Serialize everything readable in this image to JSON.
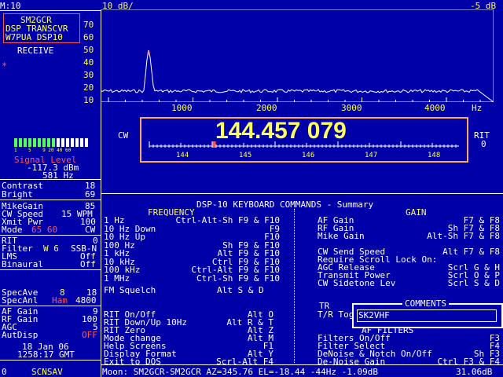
{
  "top_left": {
    "mode_label": "M:10"
  },
  "station_box": {
    "line1": "SM2GCR",
    "line2": "DSP TRANSCVR",
    "line3": "W7PUA DSP10"
  },
  "receive_label": "RECEIVE",
  "spectrum": {
    "header_left": "10 dB/",
    "header_right": "-5 dB",
    "y_ticks": [
      "70",
      "60",
      "50",
      "40",
      "30",
      "20",
      "10"
    ],
    "x_ticks": [
      "1000",
      "2000",
      "3000",
      "4000"
    ],
    "x_unit": "Hz"
  },
  "signal": {
    "bar_scale": "1    5    9 20 40 60",
    "label": "Signal Level",
    "level": "-117.3 dBm",
    "freq": "581 Hz",
    "bars_lit_fraction": 0.55
  },
  "tuning": {
    "mode": "CW",
    "frequency": "144.457 079",
    "rit_label": "RIT",
    "rit_value": "0",
    "scale_labels": [
      "144",
      "145",
      "146",
      "147",
      "148"
    ],
    "marker_value": 144.457
  },
  "settings": {
    "contrast_label": "Contrast",
    "contrast_value": "18",
    "bright_label": "Bright",
    "bright_value": "69",
    "mikegain_label": "MikeGain",
    "mikegain_value": "85",
    "cwspeed_label": "CW Speed",
    "cwspeed_value": "15 WPM",
    "xmitpwr_label": "Xmit Pwr",
    "xmitpwr_value": "100",
    "mode_label": "Mode",
    "mode_value": "65 60",
    "mode_value2": "CW",
    "rit_label": "RIT",
    "rit_value": "0",
    "filter_label": "Filter",
    "filter_value": "W 6",
    "filter_mode": "SSB-N",
    "lms_label": "LMS",
    "lms_value": "Off",
    "binaural_label": "Binaural",
    "binaural_value": "Off",
    "specave_label": "SpecAve",
    "specave_value": "8",
    "specave_value2": "18",
    "specanl_label": "SpecAnl",
    "specanl_value": "Ham",
    "specanl_value2": "4800",
    "afgain_label": "AF Gain",
    "afgain_value": "9",
    "rfgain_label": "RF Gain",
    "rfgain_value": "100",
    "agc_label": "AGC",
    "agc_value": "5",
    "autodisp_label": "AutDisp",
    "autodisp_value": "OFF",
    "date": "18 Jan 06",
    "time": "1258:17 GMT",
    "bottom_zero": "0",
    "scnsav": "SCNSAV"
  },
  "commands": {
    "title": "DSP-10 KEYBOARD COMMANDS - Summary",
    "freq_header": "FREQUENCY",
    "gain_header": "GAIN",
    "left_items": [
      {
        "name": "1 Hz",
        "key": "Ctrl-Alt-Sh F9 & F10"
      },
      {
        "name": "10 Hz Down",
        "key": "F9"
      },
      {
        "name": "10 Hz Up",
        "key": "F10"
      },
      {
        "name": "100 Hz",
        "key": "Sh F9 & F10"
      },
      {
        "name": "1 kHz",
        "key": "Alt F9 & F10"
      },
      {
        "name": "10 kHz",
        "key": "Ctrl F9 & F10"
      },
      {
        "name": "100 kHz",
        "key": "Ctrl-Alt F9 & F10"
      },
      {
        "name": "1 MHz",
        "key": "Ctrl-Sh F9 & F10"
      }
    ],
    "squelch": {
      "name": "FM Squelch",
      "key": "Alt S & D"
    },
    "left_items2": [
      {
        "name": "RIT On/Off",
        "key": "Alt O"
      },
      {
        "name": "RIT Down/Up 10Hz",
        "key": "Alt R & T"
      },
      {
        "name": "RIT Zero",
        "key": "Alt Z"
      },
      {
        "name": "Mode change",
        "key": "Alt M"
      },
      {
        "name": "Help Screens",
        "key": "F1"
      },
      {
        "name": "Display Format",
        "key": "Alt Y"
      },
      {
        "name": "Exit to DOS",
        "key": "Scrl-Alt F4"
      }
    ],
    "right_items": [
      {
        "name": "AF Gain",
        "key": "F7 & F8"
      },
      {
        "name": "RF Gain",
        "key": "Sh F7 & F8"
      },
      {
        "name": "Mike Gain",
        "key": "Alt-Sh F7 & F8"
      }
    ],
    "right_items2": [
      {
        "name": "CW Send Speed",
        "key": "Alt F7 & F8"
      },
      {
        "name": "Require Scroll Lock On:",
        "key": ""
      },
      {
        "name": "AGC Release",
        "key": "Scrl G & H"
      },
      {
        "name": "Transmit Power",
        "key": "Scrl O & P"
      },
      {
        "name": "CW Sidetone Lev",
        "key": "Scrl S & D"
      }
    ],
    "tr_label": "TR",
    "tr_tog": "T/R Tog",
    "af_filters": "AF FILTERS",
    "right_items3": [
      {
        "name": "Filters On/Off",
        "key": "F3"
      },
      {
        "name": "Filter Select",
        "key": "F4"
      },
      {
        "name": "DeNoise & Notch On/Off",
        "key": "Sh F3"
      },
      {
        "name": "De-Noise Gain",
        "key": "Ctrl F3 & F4"
      }
    ]
  },
  "comments": {
    "title": "COMMENTS",
    "text": "SK2VHF"
  },
  "status_bar": {
    "left": "Moon: SM2GCR-SM2GCR AZ=345.76 EL=-18.44 -44Hz -1.09dB",
    "right": "31.06dB"
  }
}
